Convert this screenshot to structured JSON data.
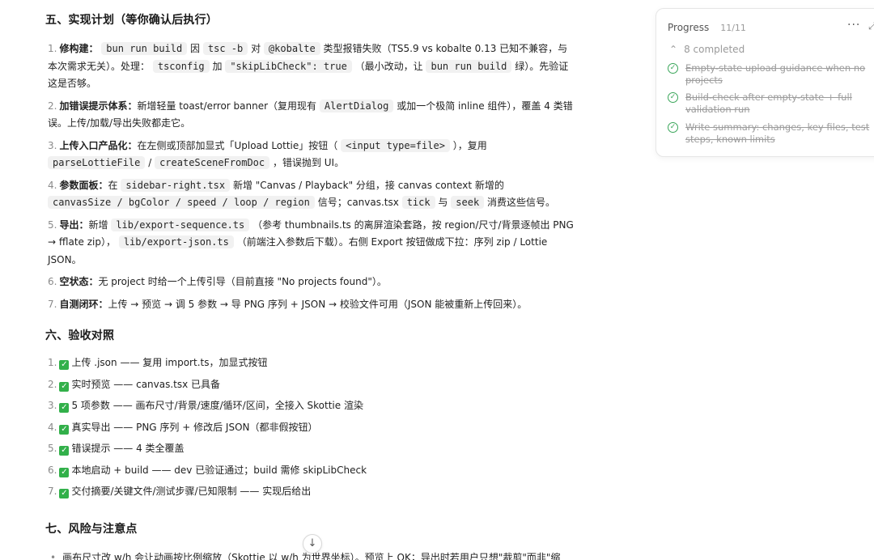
{
  "sections": {
    "s5": "五、实现计划（等你确认后执行）",
    "s6": "六、验收对照",
    "s7": "七、风险与注意点"
  },
  "plan": [
    {
      "n": "1.",
      "lead": "修构建：",
      "parts": [
        "bun run build",
        "因",
        "tsc -b",
        "对",
        "@kobalte",
        "类型报错失败（TS5.9 vs kobalte 0.13 已知不兼容，与本次需求无关）。处理：",
        "tsconfig",
        "加",
        "\"skipLibCheck\": true",
        "（最小改动，让",
        "bun run build",
        "绿）。先验证这是否够。"
      ]
    },
    {
      "n": "2.",
      "lead": "加错误提示体系：",
      "parts": [
        "新增轻量 toast/error banner（复用现有",
        "AlertDialog",
        "或加一个极简 inline 组件），覆盖 4 类错误。上传/加载/导出失败都走它。"
      ]
    },
    {
      "n": "3.",
      "lead": "上传入口产品化：",
      "parts": [
        "在左侧或顶部加显式「Upload Lottie」按钮（",
        "<input type=file>",
        "），复用",
        "parseLottieFile",
        "/",
        "createSceneFromDoc",
        "，错误抛到 UI。"
      ]
    },
    {
      "n": "4.",
      "lead": "参数面板：",
      "parts": [
        "在",
        "sidebar-right.tsx",
        "新增 \"Canvas / Playback\" 分组，接 canvas context 新增的",
        "canvasSize / bgColor / speed / loop / region",
        "信号；canvas.tsx",
        "tick",
        "与",
        "seek",
        "消费这些信号。"
      ]
    },
    {
      "n": "5.",
      "lead": "导出：",
      "parts": [
        "新增",
        "lib/export-sequence.ts",
        "（参考 thumbnails.ts 的离屏渲染套路，按 region/尺寸/背景逐帧出 PNG → fflate zip），",
        "lib/export-json.ts",
        "（前端注入参数后下载）。右侧 Export 按钮做成下拉：序列 zip / Lottie JSON。"
      ]
    },
    {
      "n": "6.",
      "lead": "空状态：",
      "parts": [
        "无 project 时给一个上传引导（目前直接 \"No projects found\"）。"
      ]
    },
    {
      "n": "7.",
      "lead": "自测闭环：",
      "parts": [
        "上传 → 预览 → 调 5 参数 → 导 PNG 序列 + JSON → 校验文件可用（JSON 能被重新上传回来）。"
      ]
    }
  ],
  "checks": [
    {
      "n": "1.",
      "lead": "上传 .json",
      "rest": " —— 复用 import.ts，加显式按钮"
    },
    {
      "n": "2.",
      "lead": "实时预览",
      "rest": " —— canvas.tsx 已具备"
    },
    {
      "n": "3.",
      "lead": "5 项参数",
      "rest": " —— 画布尺寸/背景/速度/循环/区间，全接入 Skottie 渲染"
    },
    {
      "n": "4.",
      "lead": "真实导出",
      "rest": " —— PNG 序列 + 修改后 JSON（都非假按钮）"
    },
    {
      "n": "5.",
      "lead": "错误提示",
      "rest": " —— 4 类全覆盖"
    },
    {
      "n": "6.",
      "lead": "本地启动 + build",
      "rest": " —— dev 已验证通过；build 需修 skipLibCheck"
    },
    {
      "n": "7.",
      "lead": "交付摘要/关键文件/测试步骤/已知限制",
      "rest": " —— 实现后给出"
    }
  ],
  "risk_bullet": "画布尺寸改 w/h 会让动画按比例缩放（Skottie 以 w/h 为世界坐标）。预览上 OK；导出时若用户只想\"裁剪\"而非\"缩",
  "progress": {
    "title": "Progress",
    "count": "11/11",
    "more": "···",
    "expand": "⤢",
    "completed": "8 completed",
    "tasks": [
      "Empty-state upload guidance when no projects",
      "Build-check after empty-state + full validation run",
      "Write summary: changes, key files, test steps, known limits"
    ]
  },
  "icons": {
    "check": "white-check-mark-icon",
    "scroll": "arrow-down-icon"
  },
  "colors": {
    "check_green": "#32b04a",
    "task_green": "#3aa65a"
  }
}
